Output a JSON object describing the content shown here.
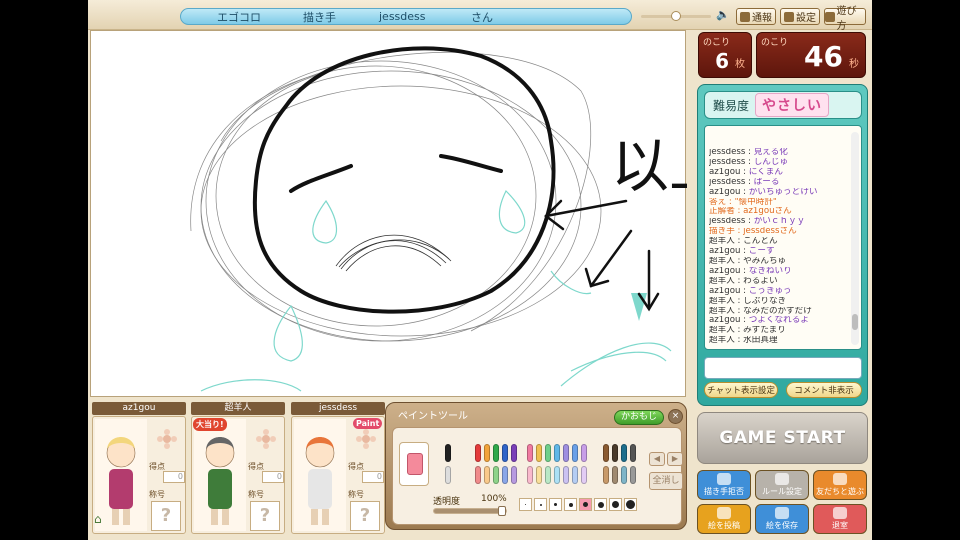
{
  "topbar": {
    "app_name": "エゴコロ",
    "drawer_label": "描き手",
    "drawer_name": "jessdess",
    "honorific": "さん",
    "volume_percent": 45,
    "buttons": [
      {
        "label": "通報",
        "icon": "report-icon"
      },
      {
        "label": "設定",
        "icon": "settings-icon"
      },
      {
        "label": "遊び方",
        "icon": "help-icon"
      }
    ]
  },
  "counters": {
    "remaining_cards_label": "のこり",
    "remaining_cards": "6",
    "cards_unit": "枚",
    "remaining_time_label": "のこり",
    "remaining_time": "46",
    "time_unit": "秒"
  },
  "difficulty": {
    "label": "難易度",
    "value": "やさしい"
  },
  "chat": {
    "lines": [
      {
        "user": "jessdess",
        "text": "見える化",
        "color": "#7a3bb8"
      },
      {
        "user": "jessdess",
        "text": "しんじゅ",
        "color": "#7a3bb8"
      },
      {
        "user": "az1gou",
        "text": "にくまん",
        "color": "#7a3bb8"
      },
      {
        "user": "jessdess",
        "text": "ぱーる",
        "color": "#7a3bb8"
      },
      {
        "user": "az1gou",
        "text": "かいちゅうどけい",
        "color": "#7a3bb8"
      },
      {
        "user": "答え",
        "text": "\"懐中時計\"",
        "color": "#e26a1e",
        "system": true
      },
      {
        "user": "正解者",
        "text": "az1gouさん",
        "color": "#e26a1e",
        "system": true
      },
      {
        "user": "jessdess",
        "text": "かいｃｈｙｙ",
        "color": "#7a3bb8"
      },
      {
        "user": "描き手",
        "text": "jessdessさん",
        "color": "#e26a1e",
        "system": true
      },
      {
        "user": "超羊人",
        "text": "こんとん",
        "color": "#333"
      },
      {
        "user": "az1gou",
        "text": "ごーす",
        "color": "#7a3bb8"
      },
      {
        "user": "超羊人",
        "text": "やみんちゅ",
        "color": "#333"
      },
      {
        "user": "az1gou",
        "text": "なきねいり",
        "color": "#7a3bb8"
      },
      {
        "user": "超羊人",
        "text": "わるよい",
        "color": "#333"
      },
      {
        "user": "az1gou",
        "text": "こうきゅう",
        "color": "#7a3bb8"
      },
      {
        "user": "超羊人",
        "text": "しぶりなき",
        "color": "#333"
      },
      {
        "user": "超羊人",
        "text": "なみだのかずだけ",
        "color": "#333"
      },
      {
        "user": "az1gou",
        "text": "つよくなれるよ",
        "color": "#7a3bb8"
      },
      {
        "user": "超羊人",
        "text": "みずたまり",
        "color": "#333"
      },
      {
        "user": "超羊人",
        "text": "水田真理",
        "color": "#333"
      }
    ],
    "input_value": "",
    "buttons": {
      "chat_settings": "チャット表示設定",
      "hide_comments": "コメント非表示"
    }
  },
  "game_start": "GAME START",
  "actions": [
    {
      "label": "描き手拒否",
      "icon": "reject-icon",
      "color": "#3f8fd8"
    },
    {
      "label": "ルール設定",
      "icon": "rules-icon",
      "color": "#b7b2aa"
    },
    {
      "label": "友だちと遊ぶ",
      "icon": "friends-icon",
      "color": "#e98a2c"
    },
    {
      "label": "絵を投稿",
      "icon": "post-icon",
      "color": "#e7a21e"
    },
    {
      "label": "絵を保存",
      "icon": "camera-icon",
      "color": "#3f8fd8"
    },
    {
      "label": "退室",
      "icon": "exit-icon",
      "color": "#e05a5a"
    }
  ],
  "players": [
    {
      "name": "az1gou",
      "score_label": "得点",
      "score": "0",
      "title_label": "称号",
      "title": "?",
      "badge": ""
    },
    {
      "name": "超羊人",
      "score_label": "得点",
      "score": "0",
      "title_label": "称号",
      "title": "?",
      "badge": "大当り!"
    },
    {
      "name": "jessdess",
      "score_label": "得点",
      "score": "0",
      "title_label": "称号",
      "title": "?",
      "badge": "Paint"
    }
  ],
  "paint_tool": {
    "title": "ペイントツール",
    "kaomoji": "かおもじ",
    "erase_all": "全消し",
    "opacity_label": "透明度",
    "opacity_value": "100%",
    "opacity_fraction": 1.0
  },
  "canvas_text": "以上",
  "colors": {
    "accent_teal": "#2fa89f",
    "panel_bg": "#efe4cc",
    "title_blue": "#7fcbe8"
  }
}
